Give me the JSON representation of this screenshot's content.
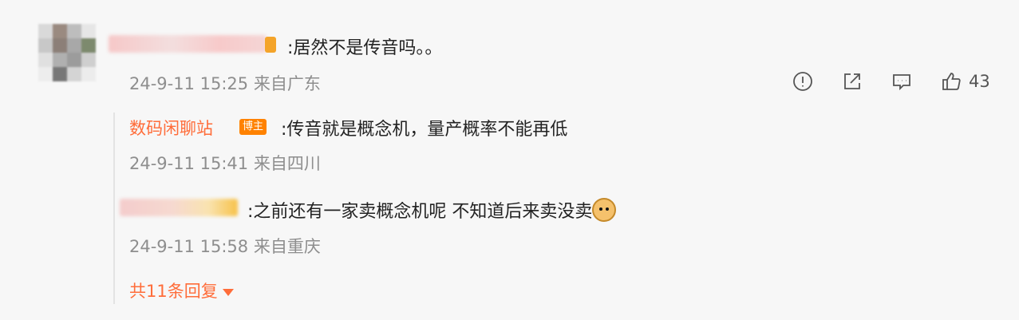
{
  "comment": {
    "text": ":居然不是传音吗。。",
    "meta": "24-9-11 15:25 来自广东",
    "like_count": "43",
    "actions": [
      {
        "icon": "report-icon"
      },
      {
        "icon": "share-icon"
      },
      {
        "icon": "comment-icon"
      },
      {
        "icon": "thumbs-up-icon"
      }
    ]
  },
  "replies": [
    {
      "author": "数码闲聊站",
      "badge": "博主",
      "text": ":传音就是概念机，量产概率不能再低",
      "meta": "24-9-11 15:41 来自四川"
    },
    {
      "text": ":之前还有一家卖概念机呢 不知道后来卖没卖",
      "emoji": "doge-emoji",
      "meta": "24-9-11 15:58 来自重庆"
    }
  ],
  "more_replies": {
    "label": "共11条回复"
  },
  "colors": {
    "accent": "#ff6d3a",
    "badge_bg": "#ff8200"
  }
}
